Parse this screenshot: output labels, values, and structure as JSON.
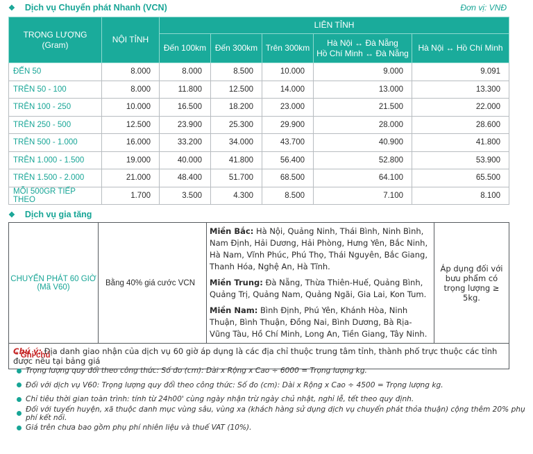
{
  "section1": {
    "bullet": "❖",
    "title": "Dịch vụ Chuyển phát Nhanh (VCN)",
    "unit": "Đơn vị: VNĐ"
  },
  "price_table": {
    "col_weight": "TRỌNG LƯỢNG",
    "col_weight_unit": "(Gram)",
    "col_local": "NỘI TỈNH",
    "col_interprov": "LIÊN TỈNH",
    "sub": {
      "to100": "Đến 100km",
      "to300": "Đến 300km",
      "over300": "Trên 300km",
      "route_a1": "Hà Nội ↔ Đà Nẵng",
      "route_a2": "Hồ Chí Minh ↔ Đà Nẵng",
      "route_b": "Hà Nội ↔ Hồ Chí Minh"
    },
    "rows": [
      {
        "label": "ĐẾN 50",
        "values": [
          "8.000",
          "8.000",
          "8.500",
          "10.000",
          "9.000",
          "9.091"
        ]
      },
      {
        "label": "TRÊN 50 - 100",
        "values": [
          "8.000",
          "11.800",
          "12.500",
          "14.000",
          "13.000",
          "13.300"
        ]
      },
      {
        "label": "TRÊN 100 - 250",
        "values": [
          "10.000",
          "16.500",
          "18.200",
          "23.000",
          "21.500",
          "22.000"
        ]
      },
      {
        "label": "TRÊN 250 - 500",
        "values": [
          "12.500",
          "23.900",
          "25.300",
          "29.900",
          "28.000",
          "28.600"
        ]
      },
      {
        "label": "TRÊN 500 - 1.000",
        "values": [
          "16.000",
          "33.200",
          "34.000",
          "43.700",
          "40.900",
          "41.800"
        ]
      },
      {
        "label": "TRÊN 1.000 - 1.500",
        "values": [
          "19.000",
          "40.000",
          "41.800",
          "56.400",
          "52.800",
          "53.900"
        ]
      },
      {
        "label": "TRÊN 1.500 - 2.000",
        "values": [
          "21.000",
          "48.400",
          "51.700",
          "68.500",
          "64.100",
          "65.500"
        ]
      },
      {
        "label": "MỖI 500GR TIẾP THEO",
        "values": [
          "1.700",
          "3.500",
          "4.300",
          "8.500",
          "7.100",
          "8.100"
        ]
      }
    ]
  },
  "section2": {
    "bullet": "❖",
    "title": "Dịch vụ gia tăng"
  },
  "vat_table": {
    "service_name": "CHUYỂN PHÁT 60 GIỜ (Mã V60)",
    "service_price": "Bằng 40% giá cước VCN",
    "north_label": "Miền Bắc:",
    "north_text": " Hà Nội, Quảng Ninh, Thái Bình, Ninh Bình, Nam Định, Hải Dương, Hải Phòng, Hưng Yên, Bắc Ninh, Hà Nam, Vĩnh Phúc, Phú Thọ, Thái Nguyên, Bắc Giang, Thanh Hóa, Nghệ An, Hà Tĩnh.",
    "central_label": "Miền Trung:",
    "central_text": " Đà Nẵng, Thừa Thiên-Huế, Quảng Bình, Quảng Trị, Quảng Nam, Quảng Ngãi, Gia Lai, Kon Tum.",
    "south_label": "Miền Nam:",
    "south_text": " Bình Định, Phú Yên, Khánh Hòa, Ninh Thuận, Bình Thuận, Đồng Nai, Bình Dương, Bà Rịa-Vũng Tàu, Hồ Chí Minh, Long An, Tiền Giang, Tây Ninh.",
    "apply_text": "Áp dụng đối với bưu phẩm có trọng lượng ≥ 5kg.",
    "note_label": "Chú ý:",
    "note_text": " Địa danh giao nhận của dịch vụ 60 giờ áp dụng là các địa chỉ thuộc trung tâm tỉnh, thành phố trực thuộc các tỉnh được nêu tại bảng giá"
  },
  "notes": {
    "heading": "* Ghi chú",
    "items": [
      "Trọng lượng quy đổi theo công thức: Số đo (cm): Dài x Rộng x Cao ÷ 6000 = Trọng lượng kg.",
      "Đối với dịch vụ V60: Trọng lượng quy đổi theo công thức: Số đo (cm): Dài x Rộng x Cao ÷ 4500 = Trọng lượng kg.",
      "Chỉ tiêu thời gian toàn trình: tính từ 24h00' cùng ngày nhận trừ ngày chủ nhật, nghỉ lễ, tết theo quy định.",
      "Đối với tuyến huyện, xã thuộc danh mục vùng sâu, vùng xa (khách hàng sử dụng dịch vụ chuyển phát thỏa thuận) cộng thêm 20% phụ phí kết nối.",
      "Giá trên chưa bao gồm phụ phí nhiên liệu và thuế VAT (10%)."
    ]
  },
  "colors": {
    "accent": "#1aab9b",
    "note_red": "#c62828"
  }
}
